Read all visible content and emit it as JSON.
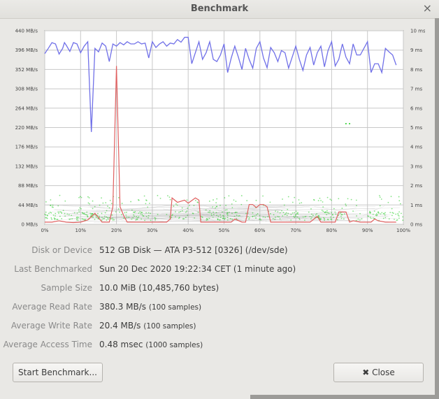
{
  "window": {
    "title": "Benchmark",
    "close_glyph": "×"
  },
  "chart_data": {
    "type": "line",
    "x_ticks": [
      "0%",
      "10%",
      "20%",
      "30%",
      "40%",
      "50%",
      "60%",
      "70%",
      "80%",
      "90%",
      "100%"
    ],
    "y_left_ticks": [
      "0 MB/s",
      "44 MB/s",
      "88 MB/s",
      "132 MB/s",
      "176 MB/s",
      "220 MB/s",
      "264 MB/s",
      "308 MB/s",
      "352 MB/s",
      "396 MB/s",
      "440 MB/s"
    ],
    "y_right_ticks": [
      "0 ms",
      "1 ms",
      "2 ms",
      "3 ms",
      "4 ms",
      "5 ms",
      "6 ms",
      "7 ms",
      "8 ms",
      "9 ms",
      "10 ms"
    ],
    "ylim_left": [
      0,
      440
    ],
    "ylim_right": [
      0,
      10
    ],
    "xlim": [
      0,
      100
    ],
    "grid": true,
    "colors": {
      "read": "#7070e8",
      "write": "#e06060",
      "access": "#22cc22"
    },
    "series": [
      {
        "values": [
          [
            0,
            388
          ],
          [
            1,
            400
          ],
          [
            2,
            413
          ],
          [
            3,
            410
          ],
          [
            4,
            387
          ],
          [
            5,
            400
          ],
          [
            5.5,
            413
          ],
          [
            6,
            407
          ],
          [
            7,
            393
          ],
          [
            8,
            413
          ],
          [
            9,
            410
          ],
          [
            10,
            390
          ],
          [
            11,
            405
          ],
          [
            12,
            415
          ],
          [
            13,
            210
          ],
          [
            14,
            400
          ],
          [
            15,
            392
          ],
          [
            16,
            412
          ],
          [
            17,
            405
          ],
          [
            18,
            370
          ],
          [
            19,
            410
          ],
          [
            20,
            405
          ],
          [
            21,
            413
          ],
          [
            22,
            408
          ],
          [
            23,
            415
          ],
          [
            24,
            410
          ],
          [
            25,
            410
          ],
          [
            26,
            415
          ],
          [
            27,
            410
          ],
          [
            28,
            412
          ],
          [
            29,
            378
          ],
          [
            30,
            415
          ],
          [
            31,
            402
          ],
          [
            32,
            410
          ],
          [
            33,
            415
          ],
          [
            34,
            405
          ],
          [
            35,
            412
          ],
          [
            36,
            410
          ],
          [
            37,
            420
          ],
          [
            38,
            414
          ],
          [
            39,
            425
          ],
          [
            40,
            425
          ],
          [
            41,
            365
          ],
          [
            42,
            390
          ],
          [
            43,
            415
          ],
          [
            44,
            375
          ],
          [
            45,
            390
          ],
          [
            46,
            415
          ],
          [
            47,
            375
          ],
          [
            48,
            370
          ],
          [
            49,
            385
          ],
          [
            50,
            410
          ],
          [
            51,
            345
          ],
          [
            52,
            378
          ],
          [
            53,
            405
          ],
          [
            54,
            380
          ],
          [
            55,
            352
          ],
          [
            56,
            400
          ],
          [
            57,
            375
          ],
          [
            58,
            355
          ],
          [
            59,
            400
          ],
          [
            60,
            415
          ],
          [
            61,
            378
          ],
          [
            62,
            356
          ],
          [
            63,
            402
          ],
          [
            64,
            390
          ],
          [
            65,
            370
          ],
          [
            66,
            395
          ],
          [
            67,
            390
          ],
          [
            68,
            355
          ],
          [
            69,
            380
          ],
          [
            70,
            405
          ],
          [
            71,
            375
          ],
          [
            72,
            350
          ],
          [
            73,
            385
          ],
          [
            74,
            402
          ],
          [
            75,
            362
          ],
          [
            76,
            390
          ],
          [
            77,
            405
          ],
          [
            78,
            358
          ],
          [
            79,
            395
          ],
          [
            80,
            415
          ],
          [
            81,
            360
          ],
          [
            82,
            375
          ],
          [
            83,
            410
          ],
          [
            84,
            380
          ],
          [
            85,
            365
          ],
          [
            86,
            410
          ],
          [
            87,
            385
          ],
          [
            88,
            385
          ],
          [
            89,
            400
          ],
          [
            90,
            415
          ],
          [
            91,
            345
          ],
          [
            92,
            365
          ],
          [
            93,
            365
          ],
          [
            94,
            345
          ],
          [
            95,
            400
          ],
          [
            96,
            392
          ],
          [
            97,
            385
          ],
          [
            98,
            362
          ]
        ]
      },
      {
        "values": [
          [
            0,
            5
          ],
          [
            2,
            5
          ],
          [
            4,
            8
          ],
          [
            6,
            5
          ],
          [
            8,
            4
          ],
          [
            10,
            5
          ],
          [
            12,
            10
          ],
          [
            14,
            25
          ],
          [
            16,
            5
          ],
          [
            18,
            5
          ],
          [
            19,
            40
          ],
          [
            20,
            360
          ],
          [
            21,
            40
          ],
          [
            22,
            20
          ],
          [
            23,
            5
          ],
          [
            25,
            5
          ],
          [
            28,
            5
          ],
          [
            31,
            5
          ],
          [
            34,
            5
          ],
          [
            35,
            12
          ],
          [
            35.5,
            60
          ],
          [
            37,
            50
          ],
          [
            39,
            55
          ],
          [
            40,
            48
          ],
          [
            42,
            60
          ],
          [
            43,
            55
          ],
          [
            43.5,
            5
          ],
          [
            46,
            5
          ],
          [
            48,
            5
          ],
          [
            50,
            5
          ],
          [
            52,
            5
          ],
          [
            53,
            12
          ],
          [
            55,
            5
          ],
          [
            56,
            5
          ],
          [
            57,
            45
          ],
          [
            58,
            45
          ],
          [
            59,
            38
          ],
          [
            60,
            45
          ],
          [
            61,
            45
          ],
          [
            62,
            40
          ],
          [
            63,
            5
          ],
          [
            66,
            5
          ],
          [
            69,
            5
          ],
          [
            72,
            5
          ],
          [
            74,
            5
          ],
          [
            76,
            18
          ],
          [
            77,
            5
          ],
          [
            78,
            5
          ],
          [
            79,
            5
          ],
          [
            81,
            5
          ],
          [
            82,
            28
          ],
          [
            84,
            28
          ],
          [
            85,
            5
          ],
          [
            86,
            8
          ],
          [
            88,
            5
          ],
          [
            91,
            5
          ],
          [
            92,
            12
          ],
          [
            93,
            8
          ],
          [
            95,
            5
          ],
          [
            97,
            5
          ],
          [
            98,
            5
          ]
        ]
      }
    ]
  },
  "info": {
    "disk_label": "Disk or Device",
    "disk_value": "512 GB Disk — ATA P3-512 [0326] (/dev/sde)",
    "last_label": "Last Benchmarked",
    "last_value": "Sun 20 Dec 2020 19:22:34 CET (1 minute ago)",
    "sample_label": "Sample Size",
    "sample_value": "10.0 MiB (10,485,760 bytes)",
    "read_label": "Average Read Rate",
    "read_value": "380.3 MB/s",
    "read_note": "(100 samples)",
    "write_label": "Average Write Rate",
    "write_value": "20.4 MB/s",
    "write_note": "(100 samples)",
    "access_label": "Average Access Time",
    "access_value": "0.48 msec",
    "access_note": "(1000 samples)"
  },
  "buttons": {
    "start_label": "Start Benchmark...",
    "close_label": "Close",
    "close_icon": "✖"
  }
}
